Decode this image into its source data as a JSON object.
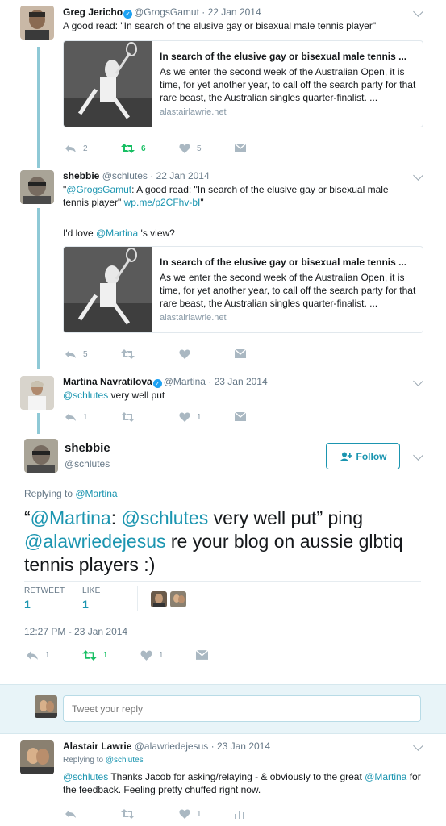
{
  "tweets": [
    {
      "name": "Greg Jericho",
      "handle": "@GrogsGamut",
      "date": "22 Jan 2014",
      "text": "A good read: \"In search of the elusive gay or bisexual male tennis player\"",
      "card": {
        "title": "In search of the elusive gay or bisexual male tennis ...",
        "description": "As we enter the second week of the Australian Open, it is time, for yet another year, to call off the search party for that rare beast, the Australian singles quarter-finalist. ...",
        "domain": "alastairlawrie.net"
      },
      "actions": {
        "reply": "2",
        "retweet": "6",
        "like": "5"
      }
    },
    {
      "name": "shebbie",
      "handle": "@schlutes",
      "date": "22 Jan 2014",
      "text_open_quote": "\"",
      "text_mention": "@GrogsGamut",
      "text_rest": ": A good read: \"In search of the elusive gay or bisexual male tennis player\" ",
      "text_link": "wp.me/p2CFhv-bI",
      "text_close_quote": "\"",
      "text2_pre": "I'd love ",
      "text2_mention": "@Martina",
      "text2_post": " 's view?",
      "card": {
        "title": "In search of the elusive gay or bisexual male tennis ...",
        "description": "As we enter the second week of the Australian Open, it is time, for yet another year, to call off the search party for that rare beast, the Australian singles quarter-finalist. ...",
        "domain": "alastairlawrie.net"
      },
      "actions": {
        "reply": "5",
        "retweet": "",
        "like": ""
      }
    },
    {
      "name": "Martina Navratilova",
      "handle": "@Martina",
      "date": "23 Jan 2014",
      "text_mention": "@schlutes",
      "text_rest": " very well put",
      "actions": {
        "reply": "1",
        "retweet": "",
        "like": "1"
      }
    }
  ],
  "main_tweet": {
    "name": "shebbie",
    "handle": "@schlutes",
    "follow_label": "Follow",
    "replying_to_label": "Replying to ",
    "replying_to_handle": "@Martina",
    "text_parts": [
      "“",
      "@Martina",
      ": ",
      "@schlutes",
      " very well put” ping ",
      "@alawriedejesus",
      " re your blog on aussie glbtiq tennis players :)"
    ],
    "retweet_label": "RETWEET",
    "like_label": "LIKE",
    "retweet_count": "1",
    "like_count": "1",
    "timestamp": "12:27 PM - 23 Jan 2014",
    "actions": {
      "reply": "1",
      "retweet": "1",
      "like": "1"
    }
  },
  "reply_box": {
    "placeholder": "Tweet your reply"
  },
  "reply_tweet": {
    "name": "Alastair Lawrie",
    "handle": "@alawriedejesus",
    "date": "23 Jan 2014",
    "replying_to_label": "Replying to ",
    "replying_to_handle": "@schlutes",
    "text_mention": "@schlutes",
    "text_rest": " Thanks Jacob for asking/relaying - & obviously to the great ",
    "text_mention2": "@Martina",
    "text_rest2": " for the feedback. Feeling pretty chuffed right now.",
    "actions": {
      "reply": "",
      "retweet": "",
      "like": "1"
    }
  },
  "colors": {
    "accent": "#1b95b0",
    "retweet_active": "#17bf63",
    "muted": "#8899a6",
    "thread_line": "#8fc9d6"
  }
}
